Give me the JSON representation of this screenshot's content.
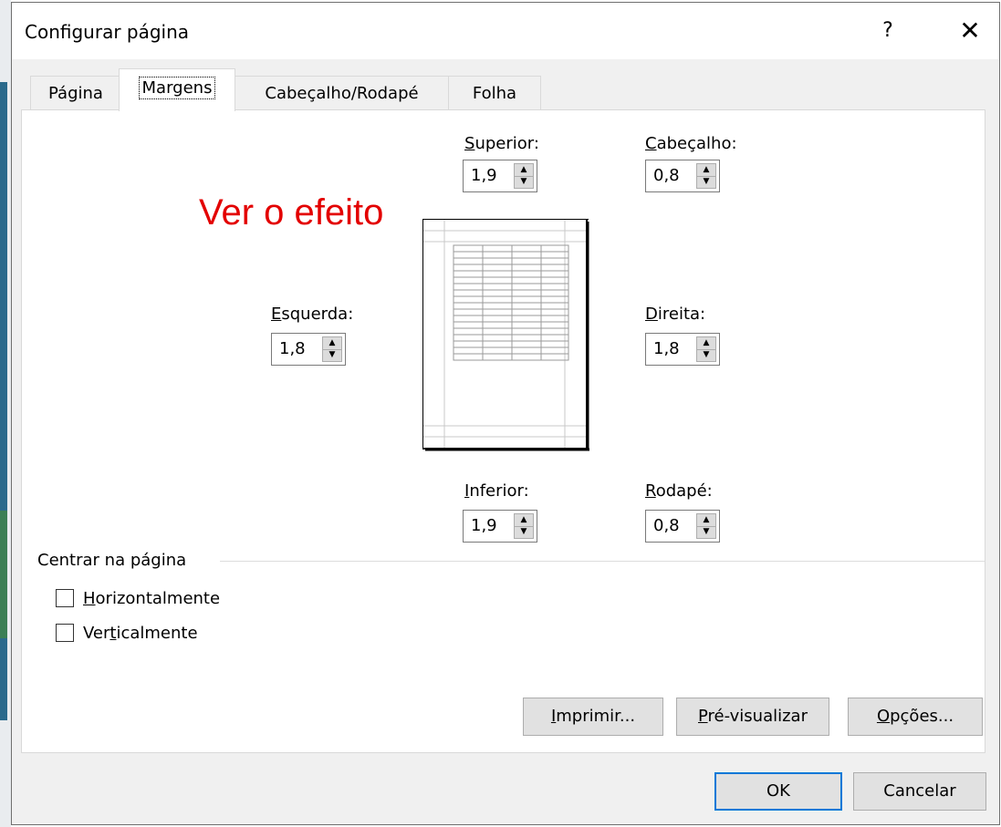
{
  "window": {
    "title": "Configurar página",
    "help_label": "?",
    "close_label": "✕"
  },
  "tabs": [
    {
      "label": "Página",
      "active": false
    },
    {
      "label": "Margens",
      "active": true
    },
    {
      "label": "Cabeçalho/Rodapé",
      "active": false
    },
    {
      "label": "Folha",
      "active": false
    }
  ],
  "margins": {
    "top": {
      "label": "Superior:",
      "value": "1,9"
    },
    "header": {
      "label": "Cabeçalho:",
      "value": "0,8"
    },
    "left": {
      "label": "Esquerda:",
      "value": "1,8"
    },
    "right": {
      "label": "Direita:",
      "value": "1,8"
    },
    "bottom": {
      "label": "Inferior:",
      "value": "1,9"
    },
    "footer": {
      "label": "Rodapé:",
      "value": "0,8"
    }
  },
  "annotation": {
    "text": "Ver o efeito",
    "color": "#e30000"
  },
  "center": {
    "group_title": "Centrar na página",
    "horizontal": {
      "label": "Horizontalmente",
      "checked": false
    },
    "vertical": {
      "label": "Verticalmente",
      "checked": false
    }
  },
  "panel_buttons": {
    "print": "Imprimir...",
    "preview": "Pré-visualizar",
    "options": "Opções..."
  },
  "dialog_buttons": {
    "ok": "OK",
    "cancel": "Cancelar"
  },
  "colors": {
    "accent": "#0078d7",
    "annotation": "#e30000"
  }
}
